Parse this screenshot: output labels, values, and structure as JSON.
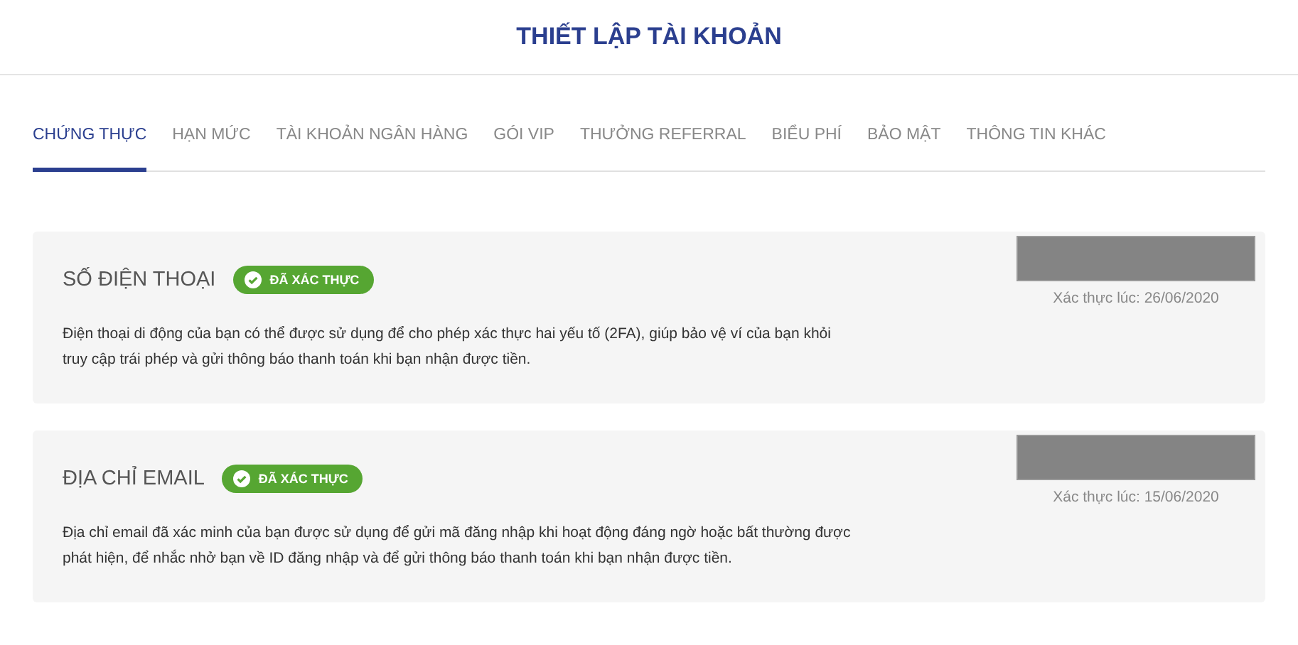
{
  "header": {
    "title": "THIẾT LẬP TÀI KHOẢN"
  },
  "tabs": [
    {
      "label": "CHỨNG THỰC",
      "selected": true
    },
    {
      "label": "HẠN MỨC",
      "selected": false
    },
    {
      "label": "TÀI KHOẢN NGÂN HÀNG",
      "selected": false
    },
    {
      "label": "GÓI VIP",
      "selected": false
    },
    {
      "label": "THƯỞNG REFERRAL",
      "selected": false
    },
    {
      "label": "BIỂU PHÍ",
      "selected": false
    },
    {
      "label": "BẢO MẬT",
      "selected": false
    },
    {
      "label": "THÔNG TIN KHÁC",
      "selected": false
    }
  ],
  "sections": [
    {
      "title": "SỐ ĐIỆN THOẠI",
      "verified": true,
      "badge": "ĐÃ XÁC THỰC",
      "description": "Điện thoại di động của bạn có thể được sử dụng để cho phép xác thực hai yếu tố (2FA), giúp bảo vệ ví của bạn khỏi truy cập trái phép và gửi thông báo thanh toán khi bạn nhận được tiền.",
      "verified_at": "Xác thực lúc: 26/06/2020"
    },
    {
      "title": "ĐỊA CHỈ EMAIL",
      "verified": true,
      "badge": "ĐÃ XÁC THỰC",
      "description": "Địa chỉ email đã xác minh của bạn được sử dụng để gửi mã đăng nhập khi hoạt động đáng ngờ hoặc bất thường được phát hiện, để nhắc nhở bạn về ID đăng nhập và để gửi thông báo thanh toán khi bạn nhận được tiền.",
      "verified_at": "Xác thực lúc: 15/06/2020"
    }
  ]
}
